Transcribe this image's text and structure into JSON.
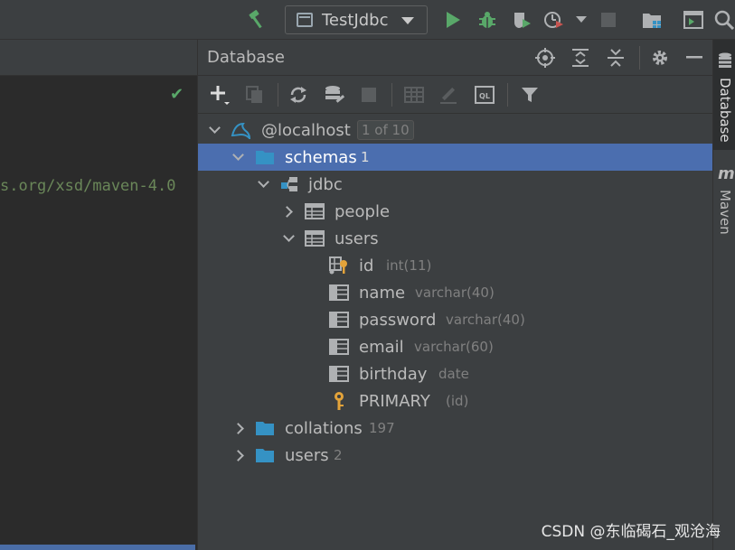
{
  "toolbar": {
    "run_config": "TestJdbc"
  },
  "editor": {
    "code_fragment": "s.org/xsd/maven-4.0"
  },
  "db_panel": {
    "title": "Database",
    "tree": [
      {
        "label": "@localhost",
        "badge": "1 of 10"
      },
      {
        "label": "schemas",
        "count": "1"
      },
      {
        "label": "jdbc"
      },
      {
        "label": "people"
      },
      {
        "label": "users"
      },
      {
        "label": "id",
        "type": "int(11)"
      },
      {
        "label": "name",
        "type": "varchar(40)"
      },
      {
        "label": "password",
        "type": "varchar(40)"
      },
      {
        "label": "email",
        "type": "varchar(60)"
      },
      {
        "label": "birthday",
        "type": "date"
      },
      {
        "label": "PRIMARY",
        "type": "(id)"
      },
      {
        "label": "collations",
        "count": "197"
      },
      {
        "label": "users",
        "count": "2"
      }
    ]
  },
  "right_bar": {
    "tab_database": "Database",
    "tab_maven": "Maven",
    "maven_glyph": "m"
  },
  "watermark": "CSDN @东临碣石_观沧海",
  "colors": {
    "selection": "#4b6eaf",
    "run_green": "#59a869",
    "folder_blue": "#3592c4",
    "key_yellow": "#e3a33a"
  },
  "icons": [
    "hammer-icon",
    "run-icon",
    "debug-icon",
    "coverage-icon",
    "profiler-icon",
    "stop-icon",
    "project-structure-icon",
    "terminal-icon",
    "search-icon",
    "locate-icon",
    "expand-all-icon",
    "collapse-all-icon",
    "gear-icon",
    "minimize-icon",
    "add-icon",
    "duplicate-icon",
    "refresh-icon",
    "schema-sync-icon",
    "stop-icon",
    "table-editor-icon",
    "edit-icon",
    "query-console-icon",
    "filter-icon"
  ]
}
